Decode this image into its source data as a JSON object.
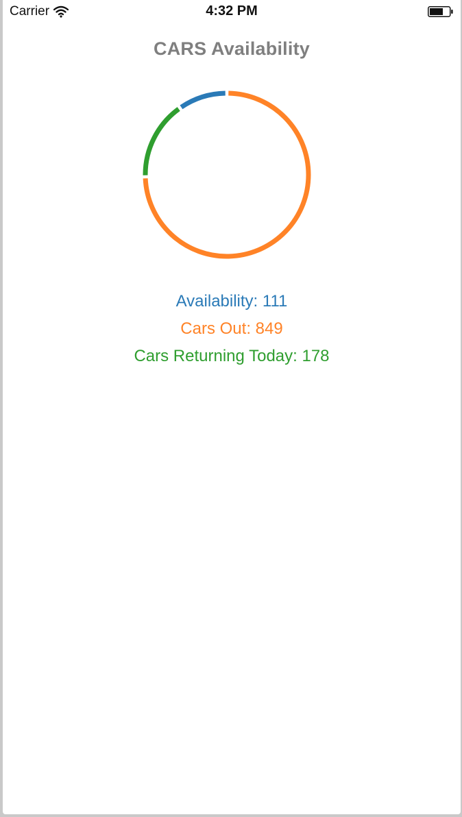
{
  "status_bar": {
    "carrier": "Carrier",
    "time": "4:32 PM",
    "signal_icon": "wifi-icon",
    "battery_icon": "battery-icon"
  },
  "page": {
    "title": "CARS Availability"
  },
  "colors": {
    "availability": "#2a7ab7",
    "cars_out": "#ff8327",
    "returning": "#2f9e2f",
    "title": "#7f7f7f"
  },
  "stats": [
    {
      "label": "Availability: 111",
      "key": "availability",
      "value": 111
    },
    {
      "label": "Cars Out: 849",
      "key": "cars_out",
      "value": 849
    },
    {
      "label": "Cars Returning Today: 178",
      "key": "returning",
      "value": 178
    }
  ],
  "chart_data": {
    "type": "pie",
    "series": [
      {
        "name": "Availability",
        "value": 111,
        "color": "#2a7ab7"
      },
      {
        "name": "Cars Out",
        "value": 849,
        "color": "#ff8327"
      },
      {
        "name": "Cars Returning Today",
        "value": 178,
        "color": "#2f9e2f"
      }
    ]
  }
}
